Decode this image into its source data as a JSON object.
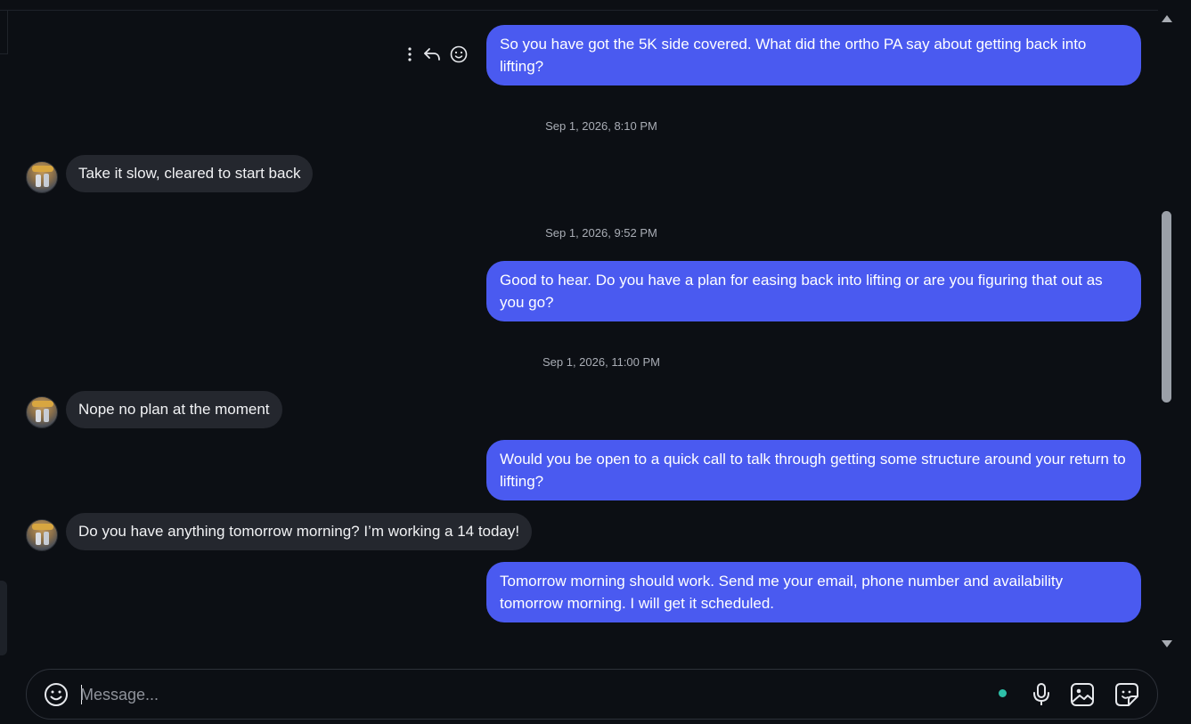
{
  "messages": [
    {
      "type": "outgoing",
      "text": "So you have got the 5K side covered. What did the ortho PA say about getting back into lifting?"
    },
    {
      "type": "timestamp",
      "text": "Sep 1, 2026, 8:10 PM"
    },
    {
      "type": "incoming",
      "text": "Take it slow, cleared to start back"
    },
    {
      "type": "timestamp",
      "text": "Sep 1, 2026, 9:52 PM"
    },
    {
      "type": "outgoing",
      "text": "Good to hear. Do you have a plan for easing back into lifting or are you figuring that out as you go?"
    },
    {
      "type": "timestamp",
      "text": "Sep 1, 2026, 11:00 PM"
    },
    {
      "type": "incoming",
      "text": "Nope no plan at the moment"
    },
    {
      "type": "outgoing",
      "text": "Would you be open to a quick call to talk through getting some structure around your return to lifting?"
    },
    {
      "type": "incoming",
      "text": "Do you have anything tomorrow morning? I’m working a 14 today!"
    },
    {
      "type": "outgoing",
      "text": "Tomorrow morning should work. Send me your email, phone number and availability tomorrow morning. I will get it scheduled."
    }
  ],
  "message_actions": {
    "icons": [
      "more-options-icon",
      "reply-icon",
      "react-emoji-icon"
    ]
  },
  "composer": {
    "placeholder": "Message...",
    "value": "",
    "icons": [
      "emoji-icon",
      "microphone-icon",
      "image-icon",
      "sticker-icon"
    ]
  },
  "colors": {
    "background": "#0c0f14",
    "outgoing_bubble": "#4a5af0",
    "incoming_bubble": "#24272e",
    "status_dot": "#2dbfa8"
  }
}
